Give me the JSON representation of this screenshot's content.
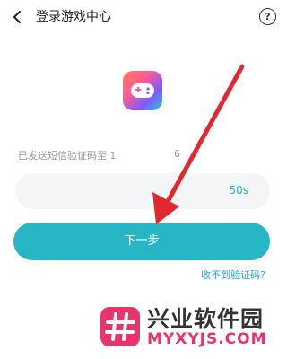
{
  "header": {
    "title": "登录游戏中心",
    "back_icon": "chevron-left-icon",
    "help_icon": "question-circle-icon",
    "help_glyph": "?"
  },
  "app": {
    "logo_icon": "gamepad-icon"
  },
  "verification": {
    "sms_hint": "已发送短信验证码至 1",
    "masked_digit": "6",
    "code_value": "",
    "countdown": "50s"
  },
  "actions": {
    "next_label": "下一步",
    "resend_link": "收不到验证码?"
  },
  "annotation": {
    "icon": "red-arrow-icon",
    "color": "#e0282e"
  },
  "watermark": {
    "name": "兴业软件园",
    "domain": "MYXYJS.COM",
    "color": "#e8336d"
  },
  "colors": {
    "accent": "#26b6c4",
    "link": "#26a6cc",
    "hint_text": "#9a9a9a",
    "field_bg": "#f3f5f6"
  }
}
